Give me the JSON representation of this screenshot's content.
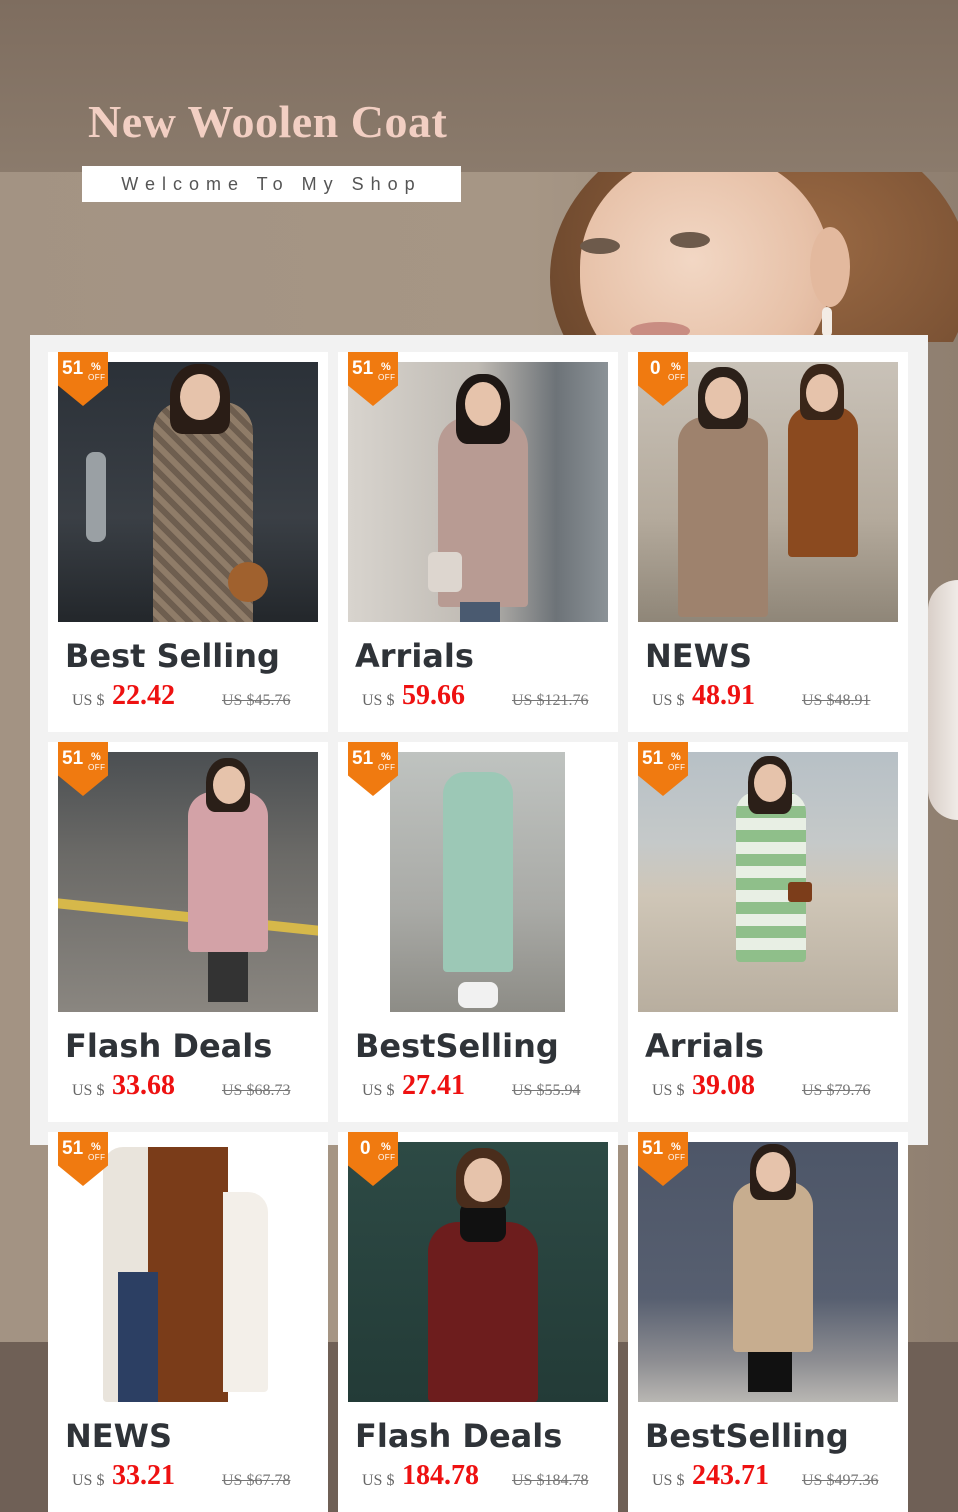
{
  "banner": {
    "title": "New Woolen Coat",
    "subtitle": "Welcome To My Shop"
  },
  "products": [
    {
      "discount": "51",
      "pct": "%",
      "off": "OFF",
      "name": "Best Selling",
      "currency": "US $",
      "price": "22.42",
      "old_price": "US $45.76"
    },
    {
      "discount": "51",
      "pct": "%",
      "off": "OFF",
      "name": "Arrials",
      "currency": "US $",
      "price": "59.66",
      "old_price": "US $121.76"
    },
    {
      "discount": "0",
      "pct": "%",
      "off": "OFF",
      "name": "NEWS",
      "currency": "US $",
      "price": "48.91",
      "old_price": "US $48.91"
    },
    {
      "discount": "51",
      "pct": "%",
      "off": "OFF",
      "name": "Flash Deals",
      "currency": "US $",
      "price": "33.68",
      "old_price": "US $68.73"
    },
    {
      "discount": "51",
      "pct": "%",
      "off": "OFF",
      "name": "BestSelling",
      "currency": "US $",
      "price": "27.41",
      "old_price": "US $55.94"
    },
    {
      "discount": "51",
      "pct": "%",
      "off": "OFF",
      "name": "Arrials",
      "currency": "US $",
      "price": "39.08",
      "old_price": "US $79.76"
    },
    {
      "discount": "51",
      "pct": "%",
      "off": "OFF",
      "name": "NEWS",
      "currency": "US $",
      "price": "33.21",
      "old_price": "US $67.78"
    },
    {
      "discount": "0",
      "pct": "%",
      "off": "OFF",
      "name": "Flash Deals",
      "currency": "US $",
      "price": "184.78",
      "old_price": "US $184.78"
    },
    {
      "discount": "51",
      "pct": "%",
      "off": "OFF",
      "name": "BestSelling",
      "currency": "US $",
      "price": "243.71",
      "old_price": "US $497.36"
    }
  ],
  "colors": {
    "badge": "#f07a10",
    "price": "#ee1111",
    "title": "#f2cfc3"
  }
}
